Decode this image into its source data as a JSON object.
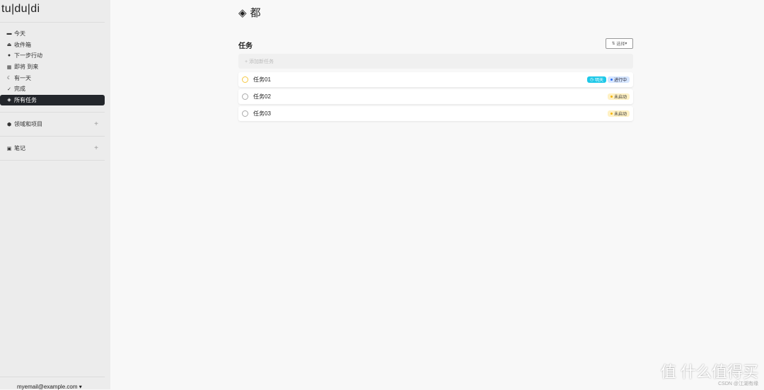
{
  "sidebar": {
    "logo": "tu|du|di",
    "items": [
      {
        "label": "今天",
        "icon": "calendar-icon"
      },
      {
        "label": "收件箱",
        "icon": "inbox-icon"
      },
      {
        "label": "下一步行动",
        "icon": "arrow-circle-icon"
      },
      {
        "label": "即将 到来",
        "icon": "calendar-upcoming-icon"
      },
      {
        "label": "有一天",
        "icon": "moon-icon"
      },
      {
        "label": "完成",
        "icon": "check-circle-icon"
      },
      {
        "label": "所有任务",
        "icon": "layers-icon"
      }
    ],
    "areas_label": "领域和项目",
    "notes_label": "笔记",
    "user_email": "myemail@example.com"
  },
  "main": {
    "title": "都",
    "section": "任务",
    "select_label": "选择",
    "add_placeholder": "+ 添加新任务",
    "tasks": [
      {
        "name": "任务01",
        "badges": [
          {
            "label": "明天",
            "bg": "#1ec8e8",
            "fg": "#fff"
          },
          {
            "label": "进行中",
            "bg": "#d6e6ff",
            "fg": "#223",
            "dot": "#2a6cf5"
          }
        ],
        "circle": "#f5c842"
      },
      {
        "name": "任务02",
        "badges": [
          {
            "label": "未启动",
            "bg": "#fff1c4",
            "fg": "#333",
            "dot": "#f5b400"
          }
        ],
        "circle": "#aaa"
      },
      {
        "name": "任务03",
        "badges": [
          {
            "label": "未启动",
            "bg": "#fff1c4",
            "fg": "#333",
            "dot": "#f5b400"
          }
        ],
        "circle": "#aaa"
      }
    ]
  },
  "watermark": {
    "text": "值 什么值得买",
    "sub": "CSDN @江湖有缘"
  }
}
